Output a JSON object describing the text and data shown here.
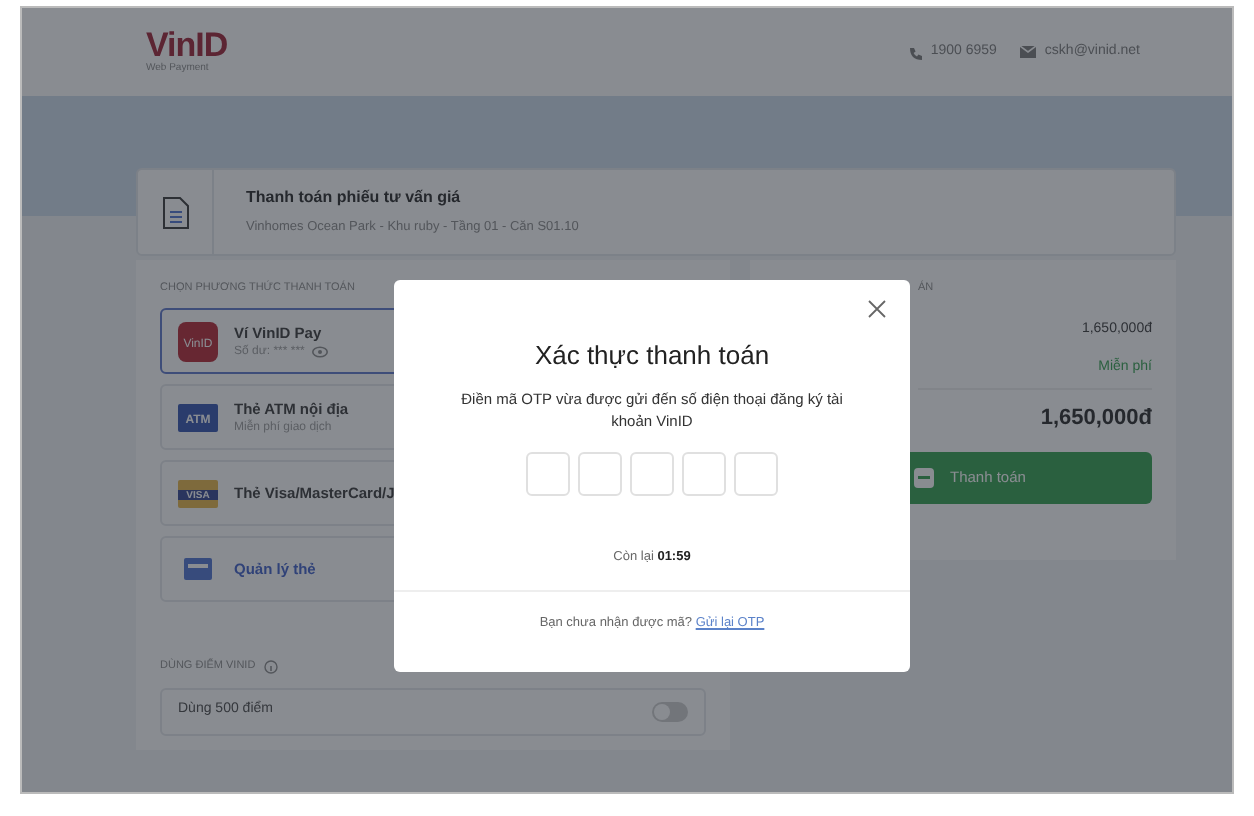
{
  "header": {
    "logo": "VinID",
    "logo_subtitle": "Web Payment",
    "phone": "1900 6959",
    "email": "cskh@vinid.net"
  },
  "order": {
    "title": "Thanh toán phiếu tư vấn giá",
    "subtitle": "Vinhomes Ocean Park - Khu ruby - Tầng 01 - Căn S01.10"
  },
  "payment": {
    "section_title": "CHỌN PHƯƠNG THỨC THANH TOÁN",
    "methods": [
      {
        "kind": "wallet",
        "icon_text": "VinID",
        "name": "Ví VinID Pay",
        "detail": "Số dư: *** ***",
        "selected": true
      },
      {
        "kind": "atm",
        "icon_text": "ATM",
        "name": "Thẻ ATM nội địa",
        "detail": "Miễn phí giao dịch",
        "selected": false
      },
      {
        "kind": "visa",
        "icon_text": "VISA",
        "name": "Thẻ Visa/MasterCard/J",
        "selected": false
      },
      {
        "kind": "manage",
        "name": "Quản lý thẻ",
        "selected": false
      }
    ]
  },
  "points": {
    "section_title": "DÙNG ĐIỂM VINID",
    "toggle": {
      "label": "Dùng 500 điểm",
      "on": false
    }
  },
  "summary": {
    "header": "ÁN",
    "amount": "1,650,000đ",
    "fee": "Miễn phí",
    "total": "1,650,000đ",
    "button": "Thanh toán"
  },
  "modal": {
    "title": "Xác thực thanh toán",
    "message": "Điền mã OTP vừa được gửi đến số điện thoại đăng ký tài khoản VinID",
    "otp_fields": [
      {
        "filled": false
      },
      {
        "filled": false
      },
      {
        "filled": false
      },
      {
        "filled": false
      },
      {
        "filled": false
      }
    ],
    "countdown": "Còn lại **01:59**",
    "footer_text": "Bạn chưa nhận được mã?",
    "resend_link": "Gửi lại OTP"
  }
}
